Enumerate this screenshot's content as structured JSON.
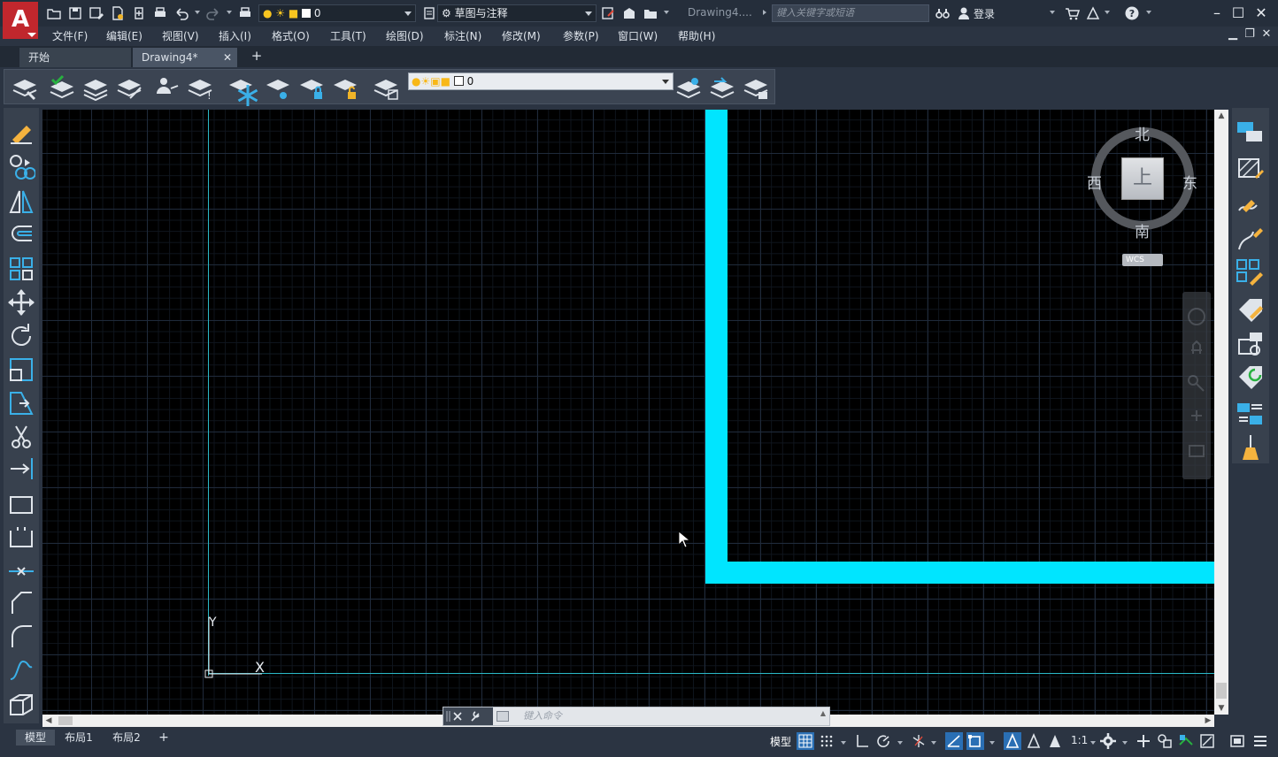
{
  "app": {
    "logo_letter": "A",
    "document_title": "Drawing4....",
    "accent": "#c1272d"
  },
  "quick_access": {
    "layer_value": "0",
    "workspace": "草图与注释",
    "search_placeholder": "键入关键字或短语",
    "login_label": "登录"
  },
  "menu": {
    "items": [
      "文件(F)",
      "编辑(E)",
      "视图(V)",
      "插入(I)",
      "格式(O)",
      "工具(T)",
      "绘图(D)",
      "标注(N)",
      "修改(M)",
      "参数(P)",
      "窗口(W)",
      "帮助(H)"
    ]
  },
  "tabs": {
    "start": "开始",
    "drawing": "Drawing4*",
    "close": "✕",
    "new": "+"
  },
  "layer_toolbar": {
    "layer_name": "0"
  },
  "viewcube": {
    "north": "北",
    "south": "南",
    "east": "东",
    "west": "西",
    "face": "上",
    "wcs": "WCS"
  },
  "ucs": {
    "x_label": "X",
    "y_label": "Y"
  },
  "command_line": {
    "placeholder": "键入命令"
  },
  "layout_tabs": {
    "model": "模型",
    "layout1": "布局1",
    "layout2": "布局2",
    "add": "+"
  },
  "status_bar": {
    "model": "模型",
    "scale": "1:1"
  },
  "colors": {
    "drawing_cyan": "#00e5ff",
    "axis_line": "#2ab8c7",
    "canvas_bg": "#000000"
  }
}
